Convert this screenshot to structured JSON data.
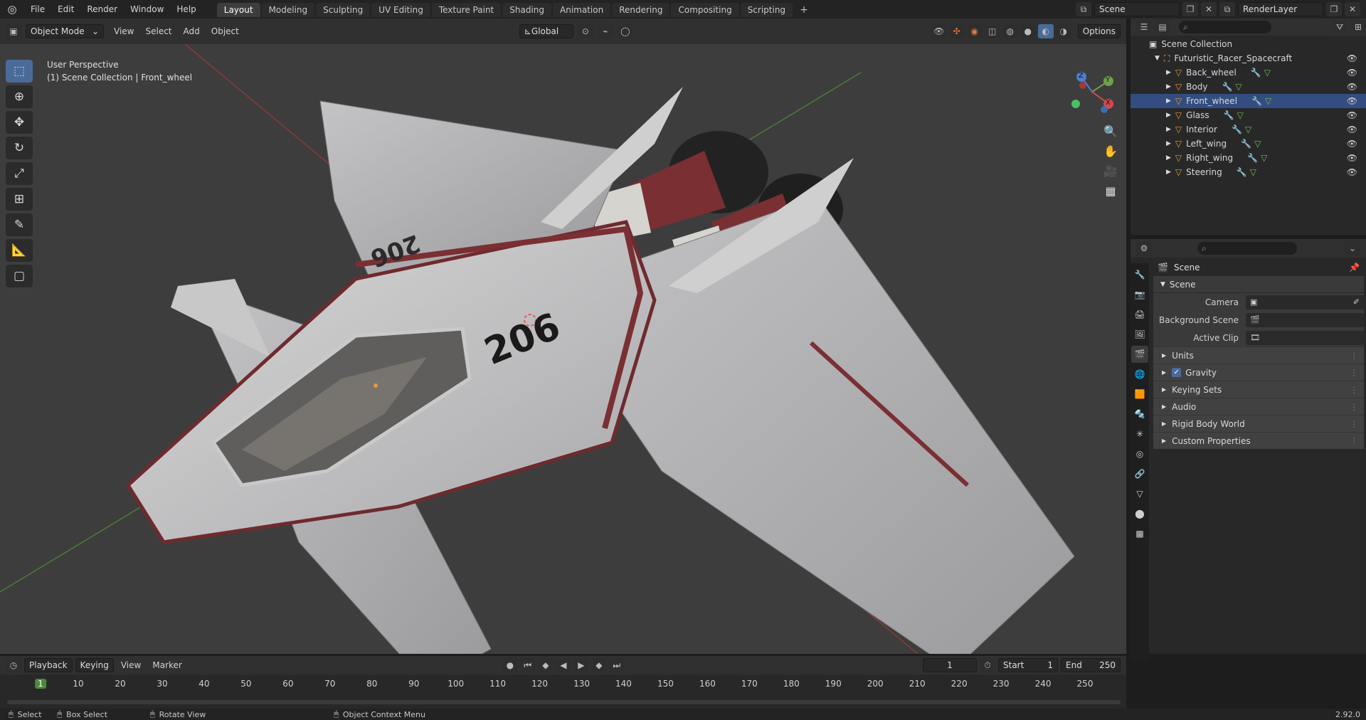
{
  "topbar": {
    "menus": [
      "File",
      "Edit",
      "Render",
      "Window",
      "Help"
    ],
    "workspaces": [
      "Layout",
      "Modeling",
      "Sculpting",
      "UV Editing",
      "Texture Paint",
      "Shading",
      "Animation",
      "Rendering",
      "Compositing",
      "Scripting"
    ],
    "active_workspace": "Layout",
    "scene_name": "Scene",
    "view_layer": "RenderLayer"
  },
  "viewport_header": {
    "mode": "Object Mode",
    "menus": [
      "View",
      "Select",
      "Add",
      "Object"
    ],
    "transform_orientation": "Global",
    "options_label": "Options"
  },
  "viewport": {
    "perspective_label": "User Perspective",
    "collection_label": "(1) Scene Collection | Front_wheel",
    "model_number": "206",
    "model_number_flipped": "206"
  },
  "gizmo": {
    "x": "X",
    "y": "Y",
    "z": "Z"
  },
  "outliner": {
    "root": "Scene Collection",
    "collection": "Futuristic_Racer_Spacecraft",
    "objects": [
      "Back_wheel",
      "Body",
      "Front_wheel",
      "Glass",
      "Interior",
      "Left_wing",
      "Right_wing",
      "Steering"
    ]
  },
  "properties": {
    "header": "Scene",
    "panel_title": "Scene",
    "fields": [
      {
        "label": "Camera",
        "value": ""
      },
      {
        "label": "Background Scene",
        "value": ""
      },
      {
        "label": "Active Clip",
        "value": ""
      }
    ],
    "subpanels": [
      "Units",
      "Gravity",
      "Keying Sets",
      "Audio",
      "Rigid Body World",
      "Custom Properties"
    ],
    "gravity_checked": true
  },
  "timeline": {
    "menus": [
      "Playback",
      "Keying",
      "View",
      "Marker"
    ],
    "current_frame": "1",
    "start_label": "Start",
    "start": "1",
    "end_label": "End",
    "end": "250",
    "ticks": [
      "1",
      "10",
      "20",
      "30",
      "40",
      "50",
      "60",
      "70",
      "80",
      "90",
      "100",
      "110",
      "120",
      "130",
      "140",
      "150",
      "160",
      "170",
      "180",
      "190",
      "200",
      "210",
      "220",
      "230",
      "240",
      "250"
    ]
  },
  "statusbar": {
    "select": "Select",
    "box_select": "Box Select",
    "rotate_view": "Rotate View",
    "context_menu": "Object Context Menu",
    "version": "2.92.0"
  },
  "colors": {
    "accent": "#4a6b9a",
    "selection": "#334d80",
    "orange": "#e69b3a",
    "hull_red": "#7a2f33"
  }
}
